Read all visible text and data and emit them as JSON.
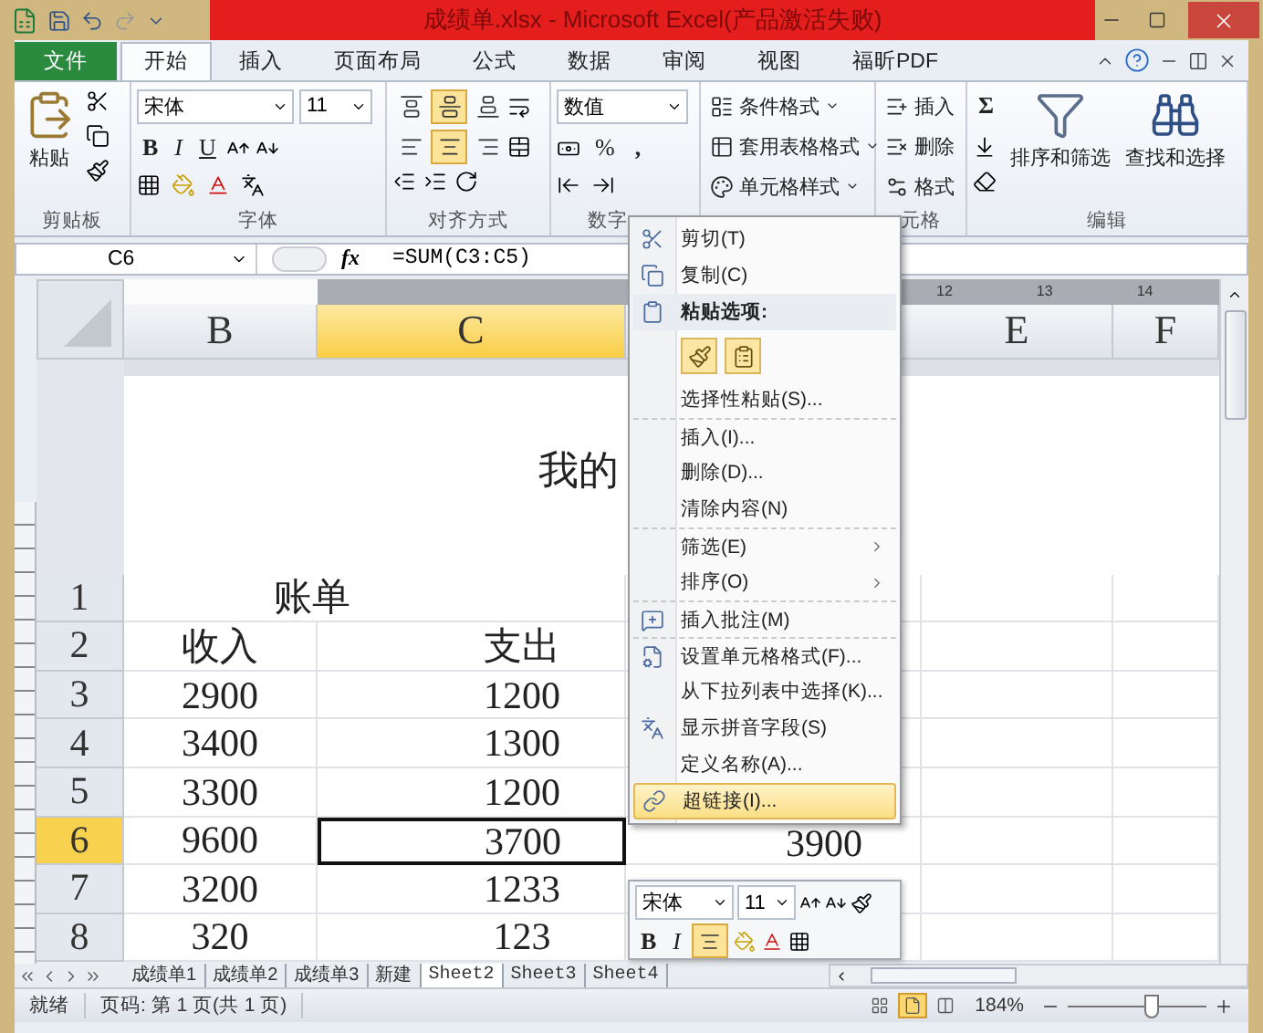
{
  "window": {
    "title": "成绩单.xlsx - Microsoft Excel(产品激活失败)"
  },
  "ribbon_tabs": [
    {
      "label": "文件",
      "kind": "file",
      "selected": false
    },
    {
      "label": "开始",
      "kind": "tab",
      "selected": true
    },
    {
      "label": "插入",
      "kind": "tab",
      "selected": false
    },
    {
      "label": "页面布局",
      "kind": "tab",
      "selected": false
    },
    {
      "label": "公式",
      "kind": "tab",
      "selected": false
    },
    {
      "label": "数据",
      "kind": "tab",
      "selected": false
    },
    {
      "label": "审阅",
      "kind": "tab",
      "selected": false
    },
    {
      "label": "视图",
      "kind": "tab",
      "selected": false
    },
    {
      "label": "福昕PDF",
      "kind": "tab",
      "selected": false
    }
  ],
  "clipboard": {
    "paste": "粘贴",
    "label": "剪贴板"
  },
  "font": {
    "name": "宋体",
    "size": "11",
    "bold": "B",
    "italic": "I",
    "underline": "U",
    "label": "字体"
  },
  "alignment": {
    "label": "对齐方式",
    "buttons": [
      {
        "selected": false
      },
      {
        "selected": true
      },
      {
        "selected": false
      },
      {
        "selected": false
      },
      {
        "selected": true
      },
      {
        "selected": false
      }
    ]
  },
  "number": {
    "format": "数值",
    "percent": "%",
    "comma": ",",
    "label": "数字"
  },
  "styles": {
    "items": [
      "条件格式",
      "套用表格格式",
      "单元格样式"
    ]
  },
  "cells": {
    "items": [
      "插入",
      "删除",
      "格式"
    ],
    "label": "元格"
  },
  "editing": {
    "sum": "Σ",
    "sort": "排序和筛选",
    "find": "查找和选择",
    "label": "编辑"
  },
  "formula_bar": {
    "name_box": "C6",
    "fx": "fx",
    "formula": "=SUM(C3:C5)"
  },
  "ruler": [
    "12",
    "13",
    "14"
  ],
  "columns": [
    {
      "label": "B",
      "selected": false
    },
    {
      "label": "C",
      "selected": true
    },
    {
      "label": "E",
      "selected": false
    },
    {
      "label": "F",
      "selected": false
    }
  ],
  "page_header": {
    "title": "我的"
  },
  "rows": [
    {
      "number": "1",
      "kind": "title",
      "selected": false,
      "b": "账单"
    },
    {
      "number": "2",
      "kind": "values",
      "selected": false,
      "b": "收入",
      "c": "支出"
    },
    {
      "number": "3",
      "kind": "values",
      "selected": false,
      "b": "2900",
      "c": "1200"
    },
    {
      "number": "4",
      "kind": "values",
      "selected": false,
      "b": "3400",
      "c": "1300"
    },
    {
      "number": "5",
      "kind": "values",
      "selected": false,
      "b": "3300",
      "c": "1200"
    },
    {
      "number": "6",
      "kind": "values",
      "selected": true,
      "b": "9600",
      "c": "3700",
      "d": "3900"
    },
    {
      "number": "7",
      "kind": "values",
      "selected": false,
      "b": "3200",
      "c": "1233"
    },
    {
      "number": "8",
      "kind": "values",
      "selected": false,
      "b": "320",
      "c": "123"
    }
  ],
  "sheet_tabs": [
    {
      "label": "成绩单1",
      "selected": false
    },
    {
      "label": "成绩单2",
      "selected": false
    },
    {
      "label": "成绩单3",
      "selected": false
    },
    {
      "label": "新建",
      "selected": false
    },
    {
      "label": "Sheet2",
      "selected": true
    },
    {
      "label": "Sheet3",
      "selected": false
    },
    {
      "label": "Sheet4",
      "selected": false
    }
  ],
  "status_bar": {
    "ready": "就绪",
    "page": "页码: 第 1 页(共 1 页)",
    "view_buttons": [
      {
        "selected": false
      },
      {
        "selected": true
      },
      {
        "selected": false
      }
    ],
    "zoom": {
      "label": "184%",
      "level": 0.6
    }
  },
  "context_menu": {
    "items": [
      {
        "kind": "command",
        "label": "剪切(T)",
        "selected": false,
        "divider": false,
        "submenu": false
      },
      {
        "kind": "command",
        "label": "复制(C)",
        "selected": false,
        "divider": false,
        "submenu": false
      },
      {
        "kind": "header",
        "label": "粘贴选项:",
        "selected": false,
        "divider": false,
        "submenu": false
      },
      {
        "kind": "paste"
      },
      {
        "kind": "command",
        "label": "选择性粘贴(S)...",
        "selected": false,
        "divider": false,
        "submenu": false
      },
      {
        "kind": "command",
        "label": "插入(I)...",
        "selected": false,
        "divider": true,
        "submenu": false
      },
      {
        "kind": "command",
        "label": "删除(D)...",
        "selected": false,
        "divider": false,
        "submenu": false
      },
      {
        "kind": "command",
        "label": "清除内容(N)",
        "selected": false,
        "divider": false,
        "submenu": false
      },
      {
        "kind": "command",
        "label": "筛选(E)",
        "selected": false,
        "divider": true,
        "submenu": true
      },
      {
        "kind": "command",
        "label": "排序(O)",
        "selected": false,
        "divider": false,
        "submenu": true
      },
      {
        "kind": "command",
        "label": "插入批注(M)",
        "selected": false,
        "divider": true,
        "submenu": false
      },
      {
        "kind": "command",
        "label": "设置单元格格式(F)...",
        "selected": false,
        "divider": true,
        "submenu": false
      },
      {
        "kind": "command",
        "label": "从下拉列表中选择(K)...",
        "selected": false,
        "divider": false,
        "submenu": false
      },
      {
        "kind": "command",
        "label": "显示拼音字段(S)",
        "selected": false,
        "divider": false,
        "submenu": false
      },
      {
        "kind": "command",
        "label": "定义名称(A)...",
        "selected": false,
        "divider": false,
        "submenu": false
      },
      {
        "kind": "command",
        "label": "超链接(I)...",
        "selected": true,
        "divider": false,
        "submenu": false
      }
    ]
  },
  "mini_toolbar": {
    "font": "宋体",
    "size": "11",
    "bold": "B",
    "italic": "I"
  }
}
